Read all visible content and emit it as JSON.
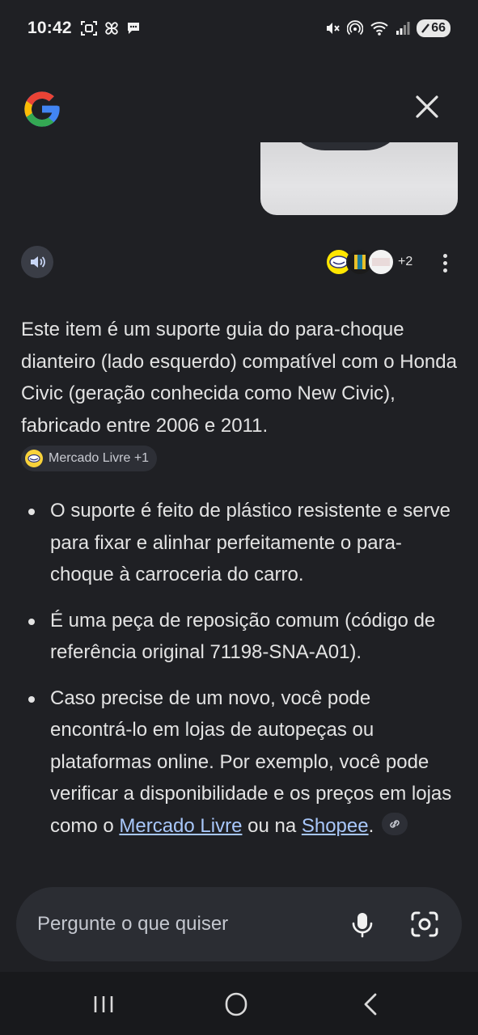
{
  "status_bar": {
    "time": "10:42",
    "battery": "66",
    "left_icons": [
      "screenshot-icon",
      "pinwheel-icon",
      "chat-bubble-icon"
    ],
    "right_icons": [
      "mute-icon",
      "hotspot-icon",
      "wifi-icon",
      "signal-icon",
      "battery-icon"
    ]
  },
  "header": {
    "logo": "google-g-logo",
    "close_icon": "close-icon"
  },
  "actions": {
    "speaker_icon": "speaker-icon",
    "sources_count": "+2",
    "more_icon": "more-vert-icon"
  },
  "response": {
    "intro": "Este item é um suporte guia do para-choque dianteiro (lado esquerdo) compatível com o Honda Civic (geração conhecida como New Civic), fabricado entre 2006 e 2011.",
    "source_chip": "Mercado Livre +1",
    "bullets": [
      "O suporte é feito de plástico resistente e serve para fixar e alinhar perfeitamente o para-choque à carroceria do carro.",
      "É uma peça de reposição comum (código de referência original 71198-SNA-A01)."
    ],
    "bullet3": {
      "text_before": "Caso precise de um novo, você pode encontrá-lo em lojas de autopeças ou plataformas online. Por exemplo, você pode verificar a disponibilidade e os preços em lojas como o ",
      "link1": "Mercado Livre",
      "text_middle": " ou na ",
      "link2": "Shopee",
      "text_after": "."
    }
  },
  "prompt": {
    "placeholder": "Pergunte o que quiser",
    "value": ""
  },
  "colors": {
    "background": "#1f2024",
    "surface": "#2b2d33",
    "text": "#e3e3e3",
    "link": "#a8c7fa"
  }
}
